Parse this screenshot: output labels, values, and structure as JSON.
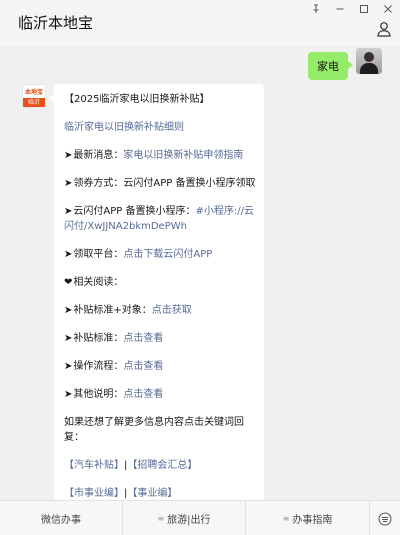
{
  "window": {
    "title": "临沂本地宝",
    "controls": {
      "pin": "⊥",
      "minimize": "—",
      "maximize": "☐",
      "close": "✕"
    }
  },
  "outgoing_message": {
    "text": "家电"
  },
  "incoming_avatar": {
    "top_text": "本地宝",
    "bottom_text": "临沂"
  },
  "incoming_message": {
    "heading": "【2025临沂家电以旧换新补贴】",
    "rules_link": "临沂家电以旧换新补贴细则",
    "latest": {
      "marker": "➤",
      "label": "最新消息：",
      "link": "家电以旧换新补贴申领指南"
    },
    "method": {
      "marker": "➤",
      "text": "领券方式：云闪付APP 备置换小程序领取"
    },
    "miniapp": {
      "marker": "➤",
      "label": "云闪付APP 备置换小程序：",
      "link": "#小程序://云闪付/XwJJNA2bkmDePWh"
    },
    "platform": {
      "marker": "➤",
      "label": "领取平台：",
      "link": "点击下载云闪付APP"
    },
    "related": {
      "marker": "❤",
      "text": "相关阅读："
    },
    "items": [
      {
        "marker": "➤",
        "label": "补贴标准+对象：",
        "link": "点击获取"
      },
      {
        "marker": "➤",
        "label": "补贴标准：",
        "link": "点击查看"
      },
      {
        "marker": "➤",
        "label": "操作流程：",
        "link": "点击查看"
      },
      {
        "marker": "➤",
        "label": "其他说明：",
        "link": "点击查看"
      }
    ],
    "more_text": "如果还想了解更多信息内容点击关键词回复：",
    "keywords_row1": {
      "a": "【汽车补贴】",
      "sep": "|",
      "b": "【招聘会汇总】"
    },
    "keywords_row2": {
      "a": "【市事业编】",
      "sep": "|",
      "b": "【事业编】"
    }
  },
  "bottom_menu": {
    "items": [
      "微信办事",
      "旅游|出行",
      "办事指南"
    ],
    "hamburger": "≡"
  },
  "colors": {
    "link": "#576b95",
    "bubble_out": "#95ec69",
    "brand": "#e8501a"
  }
}
